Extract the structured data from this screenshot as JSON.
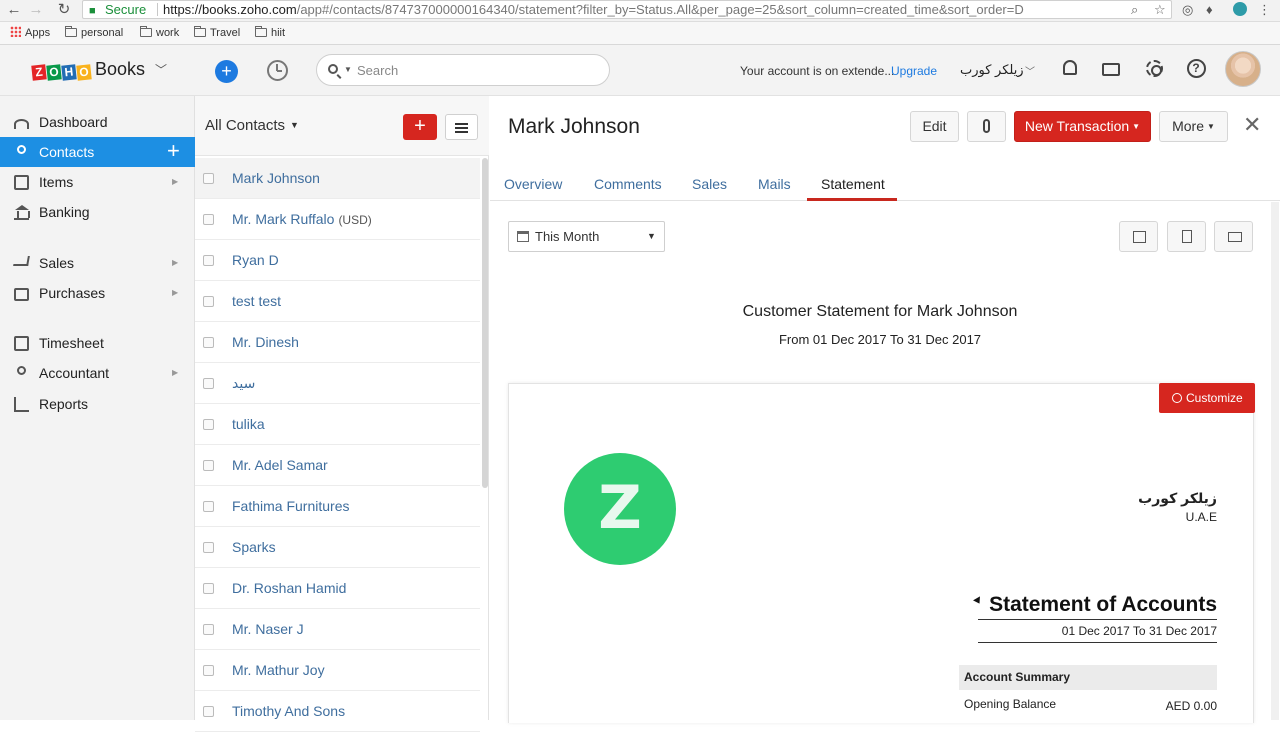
{
  "browser": {
    "secure_label": "Secure",
    "url_scheme": "https://",
    "url_host": "books.zoho.com",
    "url_path": "/app#/contacts/874737000000164340/statement?filter_by=Status.All&per_page=25&sort_column=created_time&sort_order=D",
    "bookmarks": [
      "Apps",
      "personal",
      "work",
      "Travel",
      "hiit"
    ]
  },
  "header": {
    "logo_letters": [
      "Z",
      "O",
      "H",
      "O"
    ],
    "logo_colors": [
      "#e42527",
      "#089949",
      "#226db4",
      "#f9b21d"
    ],
    "logo_text": "Books",
    "search_placeholder": "Search",
    "trial_text": "Your account is on extende...",
    "upgrade_label": "Upgrade",
    "org_name": "زيلكر كورب"
  },
  "sidebar": {
    "items": [
      {
        "label": "Dashboard"
      },
      {
        "label": "Contacts"
      },
      {
        "label": "Items"
      },
      {
        "label": "Banking"
      },
      {
        "label": "Sales"
      },
      {
        "label": "Purchases"
      },
      {
        "label": "Timesheet"
      },
      {
        "label": "Accountant"
      },
      {
        "label": "Reports"
      }
    ]
  },
  "contacts_list": {
    "title": "All Contacts",
    "rows": [
      {
        "name": "Mark Johnson",
        "currency": ""
      },
      {
        "name": "Mr. Mark Ruffalo",
        "currency": "(USD)"
      },
      {
        "name": "Ryan D",
        "currency": ""
      },
      {
        "name": "test test",
        "currency": ""
      },
      {
        "name": "Mr. Dinesh",
        "currency": ""
      },
      {
        "name": "سيد",
        "currency": ""
      },
      {
        "name": "tulika",
        "currency": ""
      },
      {
        "name": "Mr. Adel Samar",
        "currency": ""
      },
      {
        "name": "Fathima Furnitures",
        "currency": ""
      },
      {
        "name": "Sparks",
        "currency": ""
      },
      {
        "name": "Dr. Roshan Hamid",
        "currency": ""
      },
      {
        "name": "Mr. Naser J",
        "currency": ""
      },
      {
        "name": "Mr. Mathur Joy",
        "currency": ""
      },
      {
        "name": "Timothy And Sons",
        "currency": ""
      }
    ]
  },
  "detail": {
    "title": "Mark Johnson",
    "edit_label": "Edit",
    "new_transaction_label": "New Transaction",
    "more_label": "More",
    "tabs": [
      {
        "label": "Overview"
      },
      {
        "label": "Comments"
      },
      {
        "label": "Sales"
      },
      {
        "label": "Mails"
      },
      {
        "label": "Statement"
      }
    ],
    "period_label": "This Month",
    "statement_heading": "Customer Statement for Mark Johnson",
    "statement_range": "From 01 Dec 2017 To 31 Dec 2017",
    "customize_label": "Customize",
    "logo_letter": "Z",
    "org_name_ar": "زيلكر كورب",
    "org_country": "U.A.E",
    "soa_title": "Statement of Accounts",
    "soa_range": "01 Dec 2017 To 31 Dec 2017",
    "summary_header": "Account Summary",
    "opening_balance_label": "Opening Balance",
    "opening_balance_value": "AED 0.00"
  }
}
